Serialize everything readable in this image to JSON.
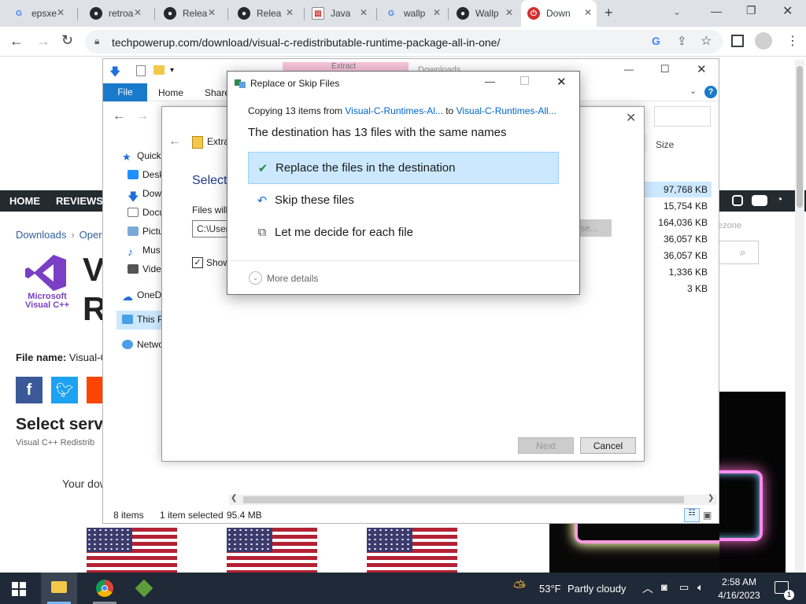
{
  "browser": {
    "tabs": [
      {
        "label": "epsxe",
        "favicon": "G"
      },
      {
        "label": "retroa",
        "favicon": "github"
      },
      {
        "label": "Relea",
        "favicon": "github"
      },
      {
        "label": "Relea",
        "favicon": "github"
      },
      {
        "label": "Java",
        "favicon": "doc"
      },
      {
        "label": "wallp",
        "favicon": "G"
      },
      {
        "label": "Wallp",
        "favicon": "github"
      },
      {
        "label": "Down",
        "favicon": "power",
        "active": true
      }
    ],
    "url": "techpowerup.com/download/visual-c-redistributable-runtime-package-all-in-one/"
  },
  "website": {
    "nav": [
      "HOME",
      "REVIEWS"
    ],
    "breadcrumb": [
      "Downloads",
      "Opera"
    ],
    "logo_text": [
      "Microsoft",
      "Visual C++"
    ],
    "title_partial": [
      "V",
      "R"
    ],
    "file_name_label": "File name:",
    "file_name_value": "Visual-C",
    "select_server": "Select serve",
    "subtitle": "Visual C++ Redistrib",
    "your_download": "Your dow",
    "placeholder_right": "ezone",
    "search_partial": "se..."
  },
  "explorer": {
    "ribbon_tabs": [
      "File",
      "Home",
      "Share"
    ],
    "ribbon_tab_behind": [
      "Extract",
      "Downloads"
    ],
    "nav_items": [
      "Quick",
      "Desk",
      "Dow",
      "Docu",
      "Pictu",
      "Mus",
      "Vide",
      "OneD",
      "This P",
      "Netwo"
    ],
    "column_size": "Size",
    "sizes": [
      "97,768 KB",
      "15,754 KB",
      "164,036 KB",
      "36,057 KB",
      "36,057 KB",
      "1,336 KB",
      "3 KB"
    ],
    "status": {
      "items": "8 items",
      "selected": "1 item selected",
      "size": "95.4 MB"
    }
  },
  "extract_wizard": {
    "folder_label": "Extra",
    "heading": "Select",
    "files_will": "Files will",
    "path_partial": "C:\\User",
    "show_label": "Show",
    "next": "Next",
    "cancel": "Cancel"
  },
  "dialog": {
    "title": "Replace or Skip Files",
    "copying_prefix": "Copying 13 items from",
    "source": "Visual-C-Runtimes-Al...",
    "to": "to",
    "destination": "Visual-C-Runtimes-All...",
    "headline": "The destination has 13 files with the same names",
    "options": [
      "Replace the files in the destination",
      "Skip these files",
      "Let me decide for each file"
    ],
    "more_details": "More details"
  },
  "taskbar": {
    "weather_temp": "53°F",
    "weather_text": "Partly cloudy",
    "time": "2:58 AM",
    "date": "4/16/2023",
    "notif_count": "1"
  },
  "colors": {
    "accent": "#0063b1",
    "dialog_link": "#0066cc",
    "selected_option": "#cce8ff",
    "nav_dark": "#232a30",
    "taskbar": "#1f2937"
  }
}
